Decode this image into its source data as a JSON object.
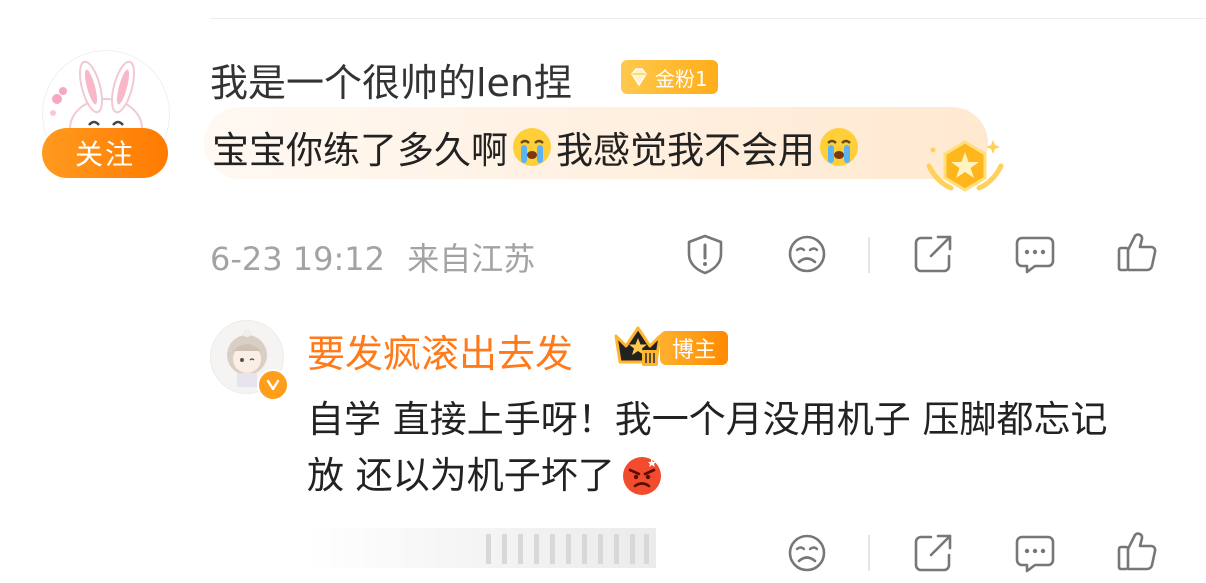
{
  "main_comment": {
    "username": "我是一个很帅的len捏",
    "fan_badge": "金粉1",
    "follow_label": "关注",
    "text_part1": "宝宝你练了多久啊",
    "text_part2": "我感觉我不会用",
    "emoji_1": "crying-face",
    "emoji_2": "crying-face",
    "timestamp": "6-23 19:12",
    "location": "来自江苏",
    "actions": [
      "report-icon",
      "dislike-icon",
      "share-icon",
      "comment-icon",
      "like-icon"
    ]
  },
  "reply": {
    "username": "要发疯滚出去发",
    "badge": "博主",
    "text_line1": "自学 直接上手呀！我一个月没用机子 压脚都忘记",
    "text_line2": "放 还以为机子坏了",
    "emoji": "angry-face",
    "actions": [
      "dislike-icon",
      "share-icon",
      "comment-icon",
      "like-icon"
    ]
  },
  "colors": {
    "accent_orange": "#ff7a00",
    "username_orange": "#ff7a1a",
    "meta_gray": "#a3a3a3",
    "badge_gold": "#ffb02e"
  }
}
